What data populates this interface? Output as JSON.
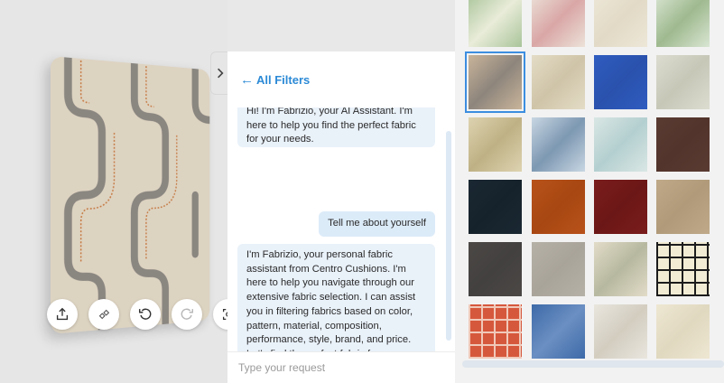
{
  "chat": {
    "back_label": "All Filters",
    "messages": [
      {
        "role": "assistant",
        "text": "Hi! I'm Fabrizio, your AI Assistant. I'm here to help you find the perfect fabric for your needs."
      },
      {
        "role": "user",
        "text": "Tell me about yourself"
      },
      {
        "role": "assistant",
        "text": "I'm Fabrizio, your personal fabric assistant from Centro Cushions. I'm here to help you navigate through our extensive fabric selection. I can assist you in filtering fabrics based on color, pattern, material, composition, performance, style, brand, and price. Let's find the perfect fabric for your pillows and cushions together."
      }
    ],
    "input_placeholder": "Type your request"
  },
  "viewer": {
    "tools": [
      {
        "name": "share-icon"
      },
      {
        "name": "texture-icon"
      },
      {
        "name": "rotate-left-icon"
      },
      {
        "name": "rotate-right-icon"
      },
      {
        "name": "view-3d-icon"
      }
    ]
  },
  "swatches": [
    {
      "name": "green-floral",
      "color": "#a9c49a",
      "accent": "#e9ecd9"
    },
    {
      "name": "pastel-plaid",
      "color": "#ece2d8",
      "accent": "#d9a6a6"
    },
    {
      "name": "ivory-linen",
      "color": "#ede7d8",
      "accent": "#e2dac6"
    },
    {
      "name": "mint-tile",
      "color": "#d9e6d3",
      "accent": "#9fb98f"
    },
    {
      "name": "geometric-loop",
      "color": "#c9b49a",
      "accent": "#8d857c",
      "selected": true
    },
    {
      "name": "cream-damask",
      "color": "#e4dcc6",
      "accent": "#cfc4a8"
    },
    {
      "name": "royal-blue",
      "color": "#2f5cc0",
      "accent": "#2a52ad"
    },
    {
      "name": "grey-floral",
      "color": "#dcdcd0",
      "accent": "#c7c7b8"
    },
    {
      "name": "tan-diamond",
      "color": "#ddd3b0",
      "accent": "#bfb185"
    },
    {
      "name": "blue-palm",
      "color": "#c8d6e2",
      "accent": "#7d98b2"
    },
    {
      "name": "aqua-stripe",
      "color": "#d9e7e4",
      "accent": "#b4cfd0"
    },
    {
      "name": "chocolate",
      "color": "#5a3b32",
      "accent": "#52342c"
    },
    {
      "name": "navy",
      "color": "#1a2833",
      "accent": "#16222b"
    },
    {
      "name": "rust",
      "color": "#b8521a",
      "accent": "#a84712"
    },
    {
      "name": "burgundy",
      "color": "#7a1c1c",
      "accent": "#6c1717"
    },
    {
      "name": "sand",
      "color": "#bfa988",
      "accent": "#b09a79"
    },
    {
      "name": "charcoal",
      "color": "#4b4845",
      "accent": "#434040"
    },
    {
      "name": "stone",
      "color": "#b6b1a7",
      "accent": "#a9a49a"
    },
    {
      "name": "blue-toile",
      "color": "#e2dcc8",
      "accent": "#b7b8a0"
    },
    {
      "name": "black-windowpane",
      "color": "#f2ecd4",
      "accent": "#1c1c1c"
    },
    {
      "name": "red-gingham",
      "color": "#d6583c",
      "accent": "#f0c9b9"
    },
    {
      "name": "blue-speckle",
      "color": "#3d6aa8",
      "accent": "#6b8fc2"
    },
    {
      "name": "ivory-leaf",
      "color": "#e9e6de",
      "accent": "#d3cdc0"
    },
    {
      "name": "cream-plain",
      "color": "#eee7d2",
      "accent": "#e0d8bf"
    }
  ]
}
